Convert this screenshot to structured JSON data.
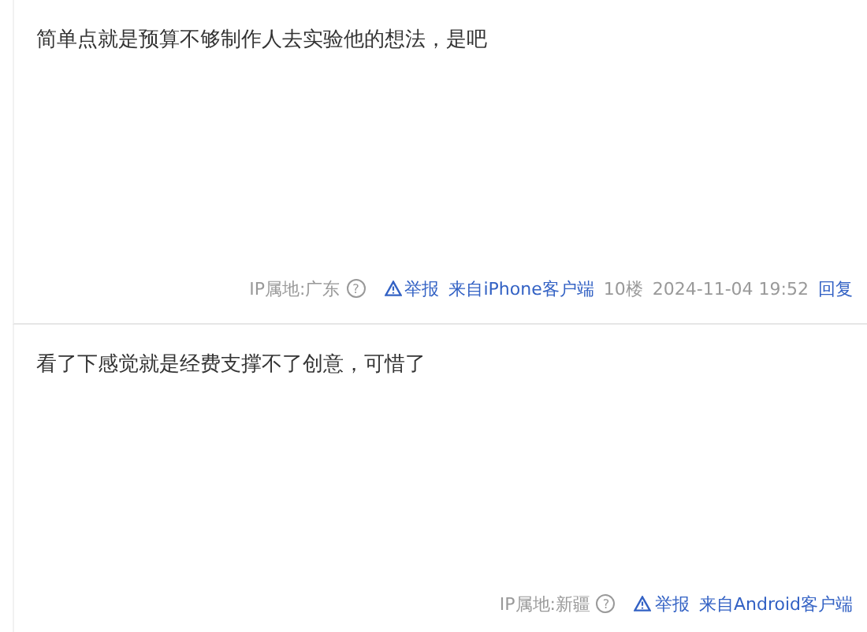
{
  "posts": [
    {
      "content": "简单点就是预算不够制作人去实验他的想法，是吧",
      "ip_location": "IP属地:广东",
      "help_icon": "?",
      "report": "举报",
      "source": "来自iPhone客户端",
      "floor": "10楼",
      "time": "2024-11-04 19:52",
      "reply": "回复"
    },
    {
      "content": "看了下感觉就是经费支撑不了创意，可惜了",
      "ip_location": "IP属地:新疆",
      "help_icon": "?",
      "report": "举报",
      "source": "来自Android客户端"
    }
  ]
}
